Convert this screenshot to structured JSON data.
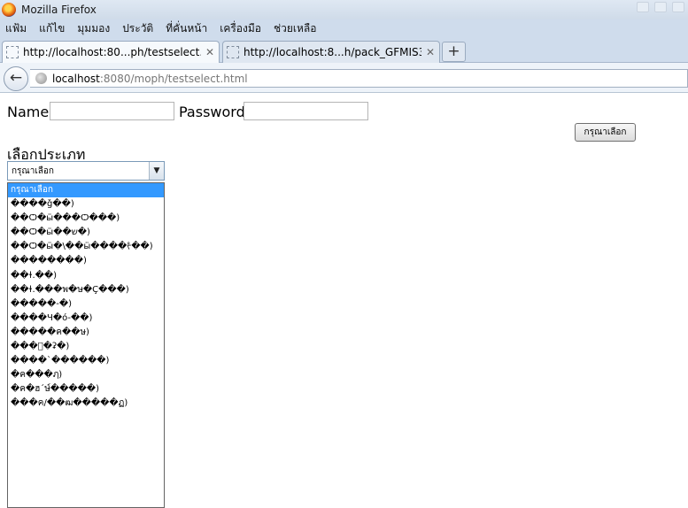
{
  "window": {
    "title": "Mozilla Firefox"
  },
  "menu": [
    "แฟ้ม",
    "แก้ไข",
    "มุมมอง",
    "ประวัติ",
    "ที่คั่นหน้า",
    "เครื่องมือ",
    "ช่วยเหลือ"
  ],
  "tabs": [
    {
      "label": "http://localhost:80...ph/testselect.html",
      "close": "✕"
    },
    {
      "label": "http://localhost:8...h/pack_GFMIS3.php",
      "close": "✕"
    }
  ],
  "newtab_label": "+",
  "nav": {
    "back_label": "←",
    "url_host": "localhost",
    "url_rest": ":8080/moph/testselect.html"
  },
  "form": {
    "name_label": "Name:",
    "name_value": "",
    "password_label": "Password:",
    "password_value": "",
    "choose_button": "กรุณาเลือก",
    "type_label": "เลือกประเภท",
    "select_value": "กรุณาเลือก",
    "select_arrow": "▼"
  },
  "options": [
    "กรุณาเลือก",
    "����ǧ��)",
    "��Ѻ�ӹ���Ѻ���)",
    "��Ѻ�ӹ��ש�)",
    "��Ѻ�ӹ�\\��ӹ����ᡷ��)",
    "��������)",
    "��ɫ.��)",
    "��ɫ.���พ�ษ�Ç���)",
    "�����-�)",
    "����Ч�ó-��)",
    "�����ค��ษ)",
    "���ฺ�ʡ�)",
    "����`������)",
    "�ค���ฦ)",
    "�ค�ฮ´ษ์�����)",
    "���ค/��ฒ�����ฏ)"
  ]
}
